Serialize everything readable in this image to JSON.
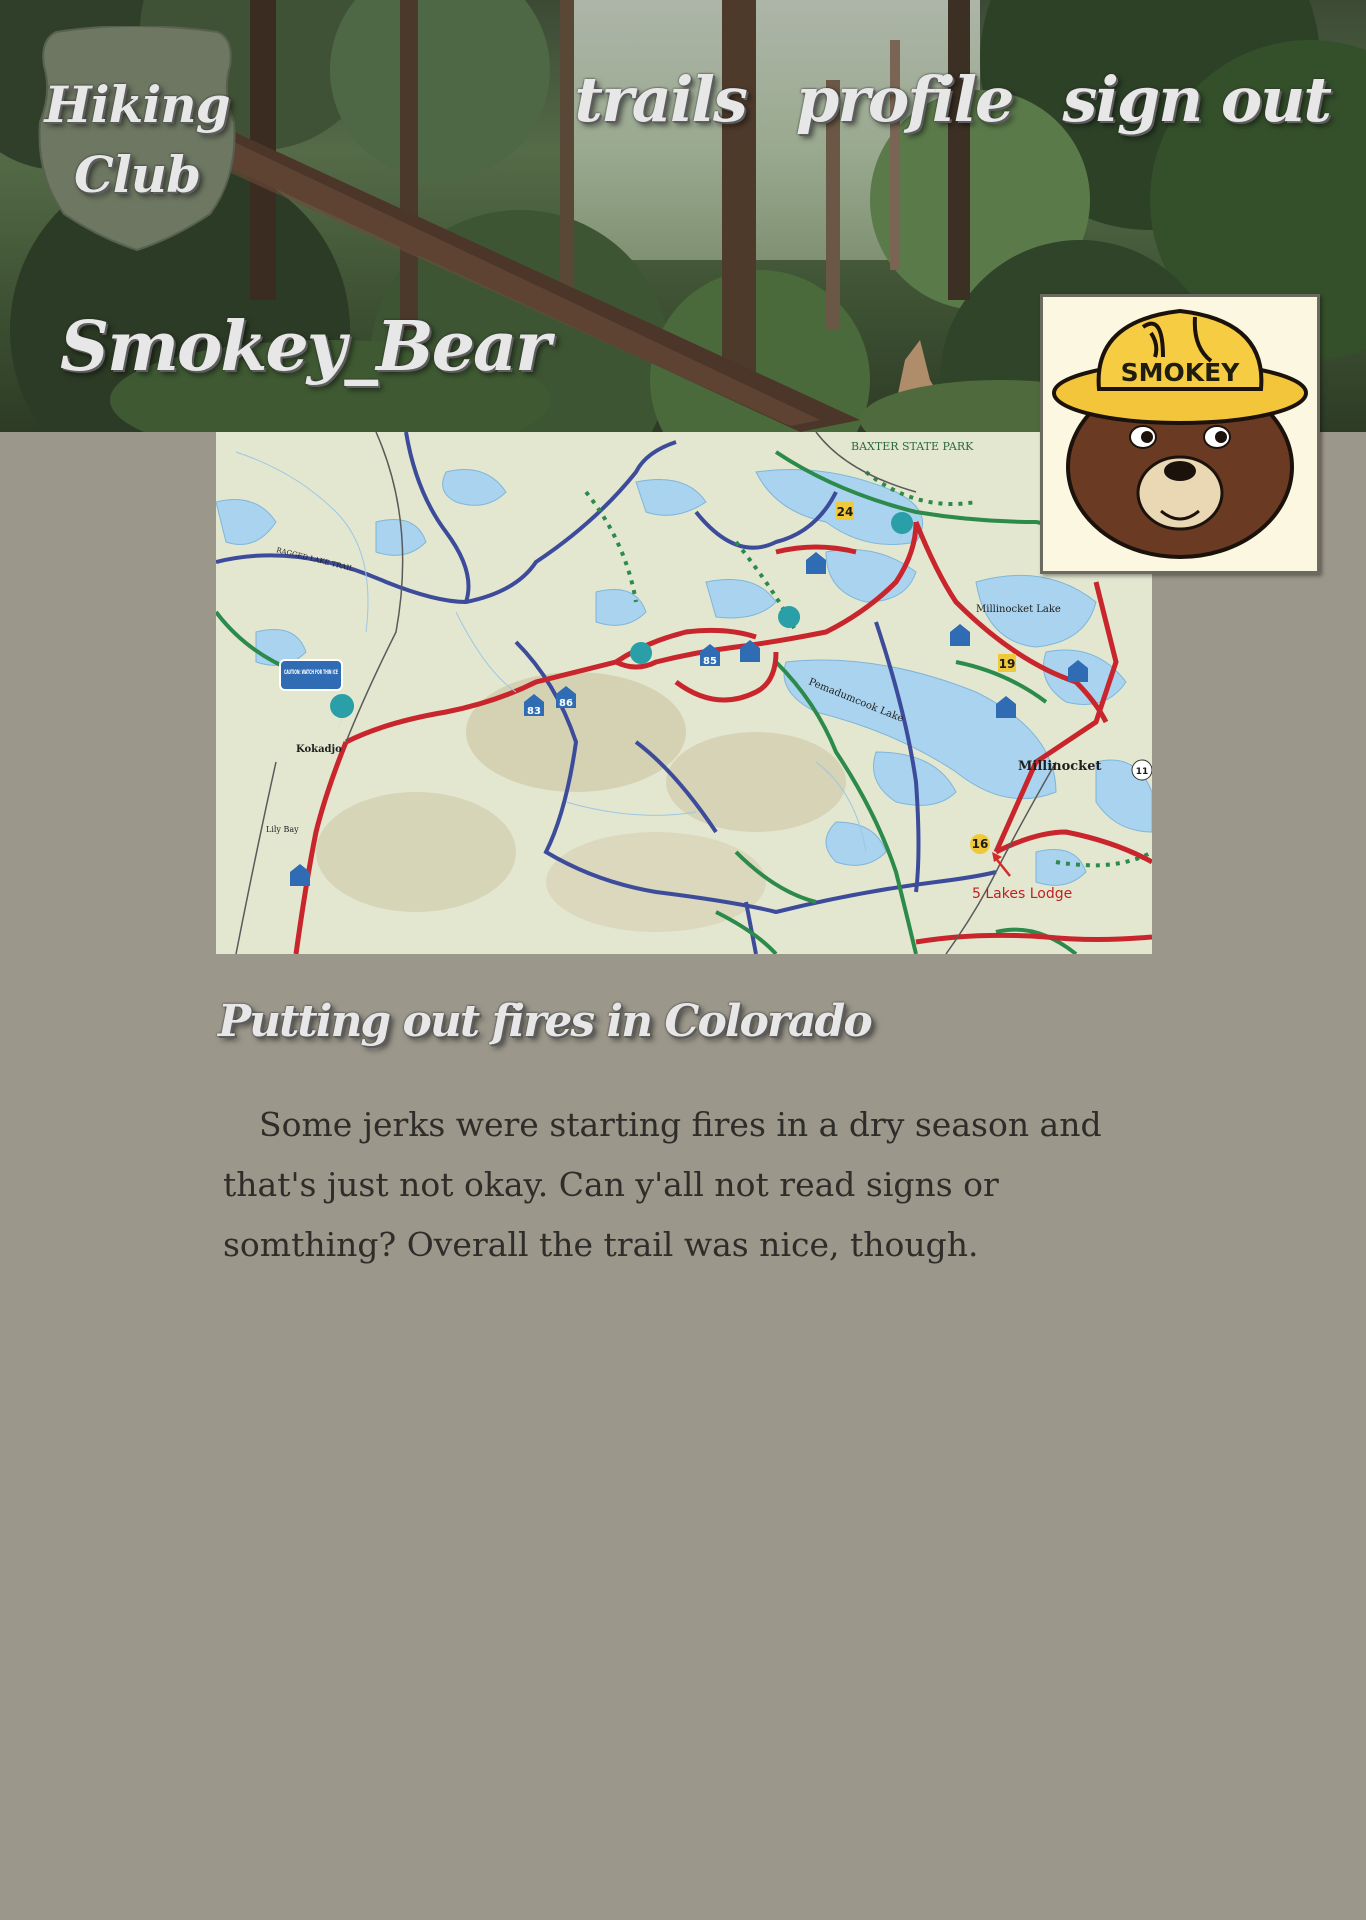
{
  "header": {
    "logo_line1": "Hiking",
    "logo_line2": "Club",
    "nav": [
      {
        "label": "trails"
      },
      {
        "label": "profile"
      },
      {
        "label": "sign out"
      }
    ],
    "username": "Smokey_Bear"
  },
  "avatar": {
    "hat_label": "SMOKEY"
  },
  "map": {
    "labels": {
      "baxter": "BAXTER STATE PARK",
      "millinocket": "Millinocket",
      "millinocket_lake": "Millinocket Lake",
      "kokadjo": "Kokadjo",
      "pemadumcook": "Pemadumcook Lake",
      "caution": "CAUTION: WATCH FOR THIN ICE",
      "lodge": "5 Lakes Lodge",
      "lily_bay": "Lily Bay",
      "ragged_lake_trail": "RAGGED LAKE TRAIL",
      "route_24": "24",
      "route_19": "19",
      "route_16": "16",
      "route_86": "86",
      "route_85": "85",
      "route_83": "83",
      "route_11": "11"
    }
  },
  "post": {
    "title": "Putting out fires in Colorado",
    "body": "Some jerks were starting fires in a dry season and that's just not okay. Can y'all not read signs or somthing? Overall the trail was nice, though."
  },
  "colors": {
    "page_background": "#9b978b",
    "logo_badge": "#6d7762",
    "script_text": "#e7e7e7",
    "body_text": "#2f2d29",
    "trail_red": "#c8262c",
    "trail_blue": "#3d4c9a",
    "trail_green": "#2c8a4a"
  }
}
